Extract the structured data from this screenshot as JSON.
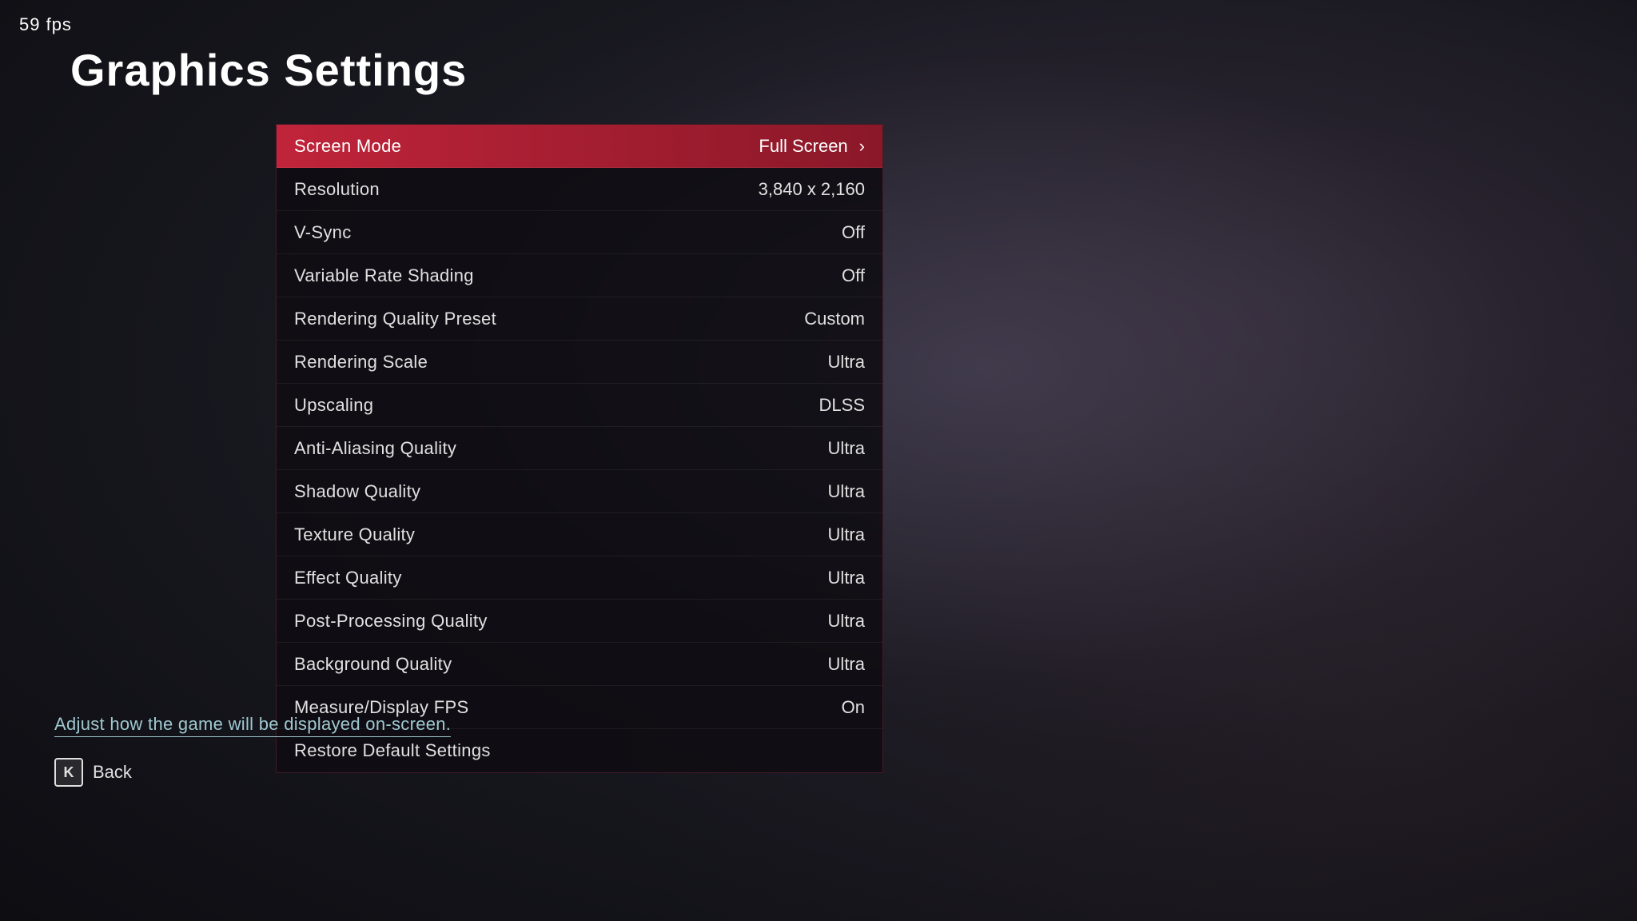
{
  "fps": {
    "label": "59 fps"
  },
  "page": {
    "title": "Graphics Settings"
  },
  "hint": {
    "text": "Adjust how the game will be displayed on-screen."
  },
  "back_button": {
    "key": "K",
    "label": "Back"
  },
  "settings": [
    {
      "id": "screen-mode",
      "label": "Screen Mode",
      "value": "Full Screen",
      "active": true,
      "has_chevron": true
    },
    {
      "id": "resolution",
      "label": "Resolution",
      "value": "3,840 x 2,160",
      "active": false,
      "has_chevron": false
    },
    {
      "id": "v-sync",
      "label": "V-Sync",
      "value": "Off",
      "active": false,
      "has_chevron": false
    },
    {
      "id": "variable-rate-shading",
      "label": "Variable Rate Shading",
      "value": "Off",
      "active": false,
      "has_chevron": false
    },
    {
      "id": "rendering-quality-preset",
      "label": "Rendering Quality Preset",
      "value": "Custom",
      "active": false,
      "has_chevron": false
    },
    {
      "id": "rendering-scale",
      "label": "Rendering Scale",
      "value": "Ultra",
      "active": false,
      "has_chevron": false
    },
    {
      "id": "upscaling",
      "label": "Upscaling",
      "value": "DLSS",
      "active": false,
      "has_chevron": false
    },
    {
      "id": "anti-aliasing-quality",
      "label": "Anti-Aliasing Quality",
      "value": "Ultra",
      "active": false,
      "has_chevron": false
    },
    {
      "id": "shadow-quality",
      "label": "Shadow Quality",
      "value": "Ultra",
      "active": false,
      "has_chevron": false
    },
    {
      "id": "texture-quality",
      "label": "Texture Quality",
      "value": "Ultra",
      "active": false,
      "has_chevron": false
    },
    {
      "id": "effect-quality",
      "label": "Effect Quality",
      "value": "Ultra",
      "active": false,
      "has_chevron": false
    },
    {
      "id": "post-processing-quality",
      "label": "Post-Processing Quality",
      "value": "Ultra",
      "active": false,
      "has_chevron": false
    },
    {
      "id": "background-quality",
      "label": "Background Quality",
      "value": "Ultra",
      "active": false,
      "has_chevron": false
    },
    {
      "id": "measure-display-fps",
      "label": "Measure/Display FPS",
      "value": "On",
      "active": false,
      "has_chevron": false
    },
    {
      "id": "restore-default-settings",
      "label": "Restore Default Settings",
      "value": "",
      "active": false,
      "has_chevron": false
    }
  ]
}
